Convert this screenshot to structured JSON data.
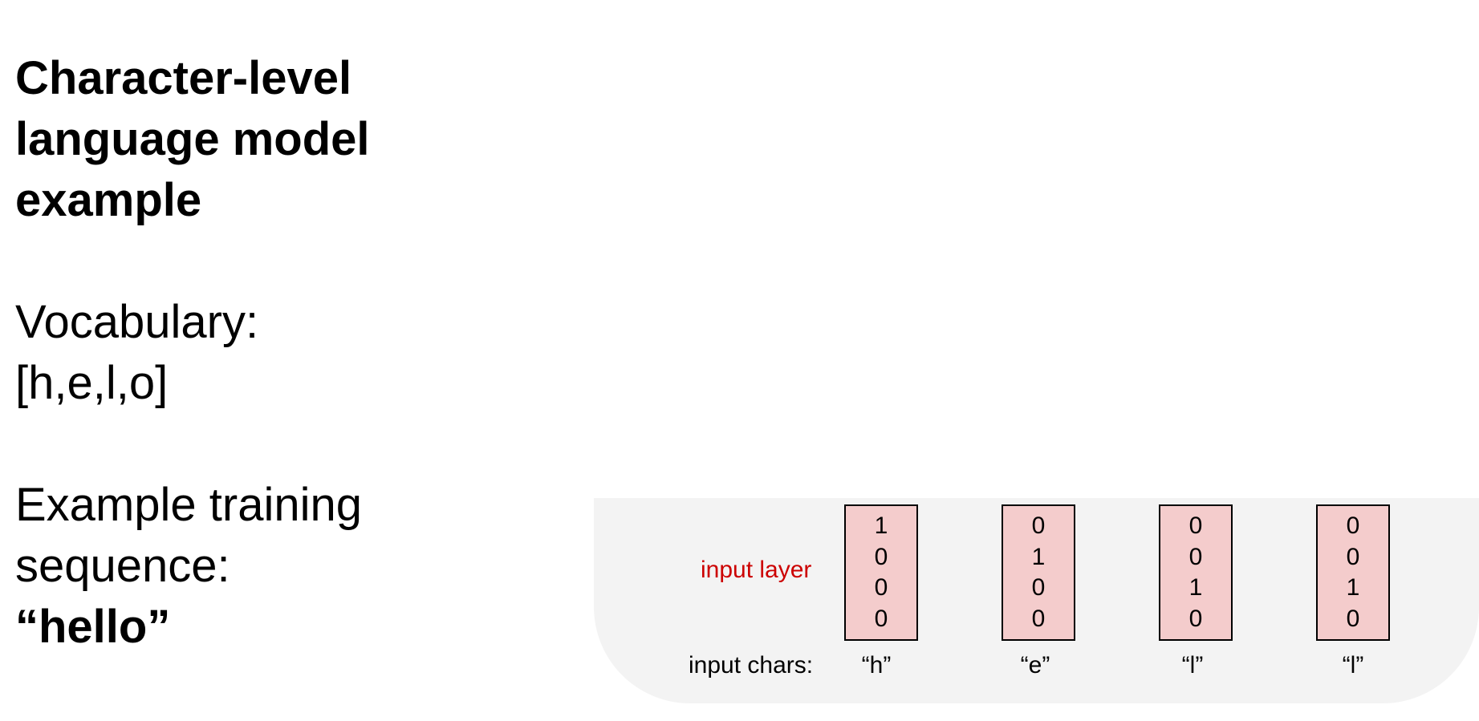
{
  "title_lines": [
    "Character-level",
    "language model",
    "example"
  ],
  "vocabulary": {
    "label": "Vocabulary:",
    "value": "[h,e,l,o]"
  },
  "training": {
    "label_line1": "Example training",
    "label_line2": "sequence:",
    "value": "“hello”"
  },
  "diagram": {
    "input_layer_label": "input layer",
    "input_chars_label": "input chars:",
    "columns": [
      {
        "char": "“h”",
        "vector": [
          "1",
          "0",
          "0",
          "0"
        ]
      },
      {
        "char": "“e”",
        "vector": [
          "0",
          "1",
          "0",
          "0"
        ]
      },
      {
        "char": "“l”",
        "vector": [
          "0",
          "0",
          "1",
          "0"
        ]
      },
      {
        "char": "“l”",
        "vector": [
          "0",
          "0",
          "1",
          "0"
        ]
      }
    ],
    "colors": {
      "input_layer_label": "#cc0000",
      "vector_fill": "#f4cccc",
      "panel_background": "#f3f3f3"
    }
  }
}
